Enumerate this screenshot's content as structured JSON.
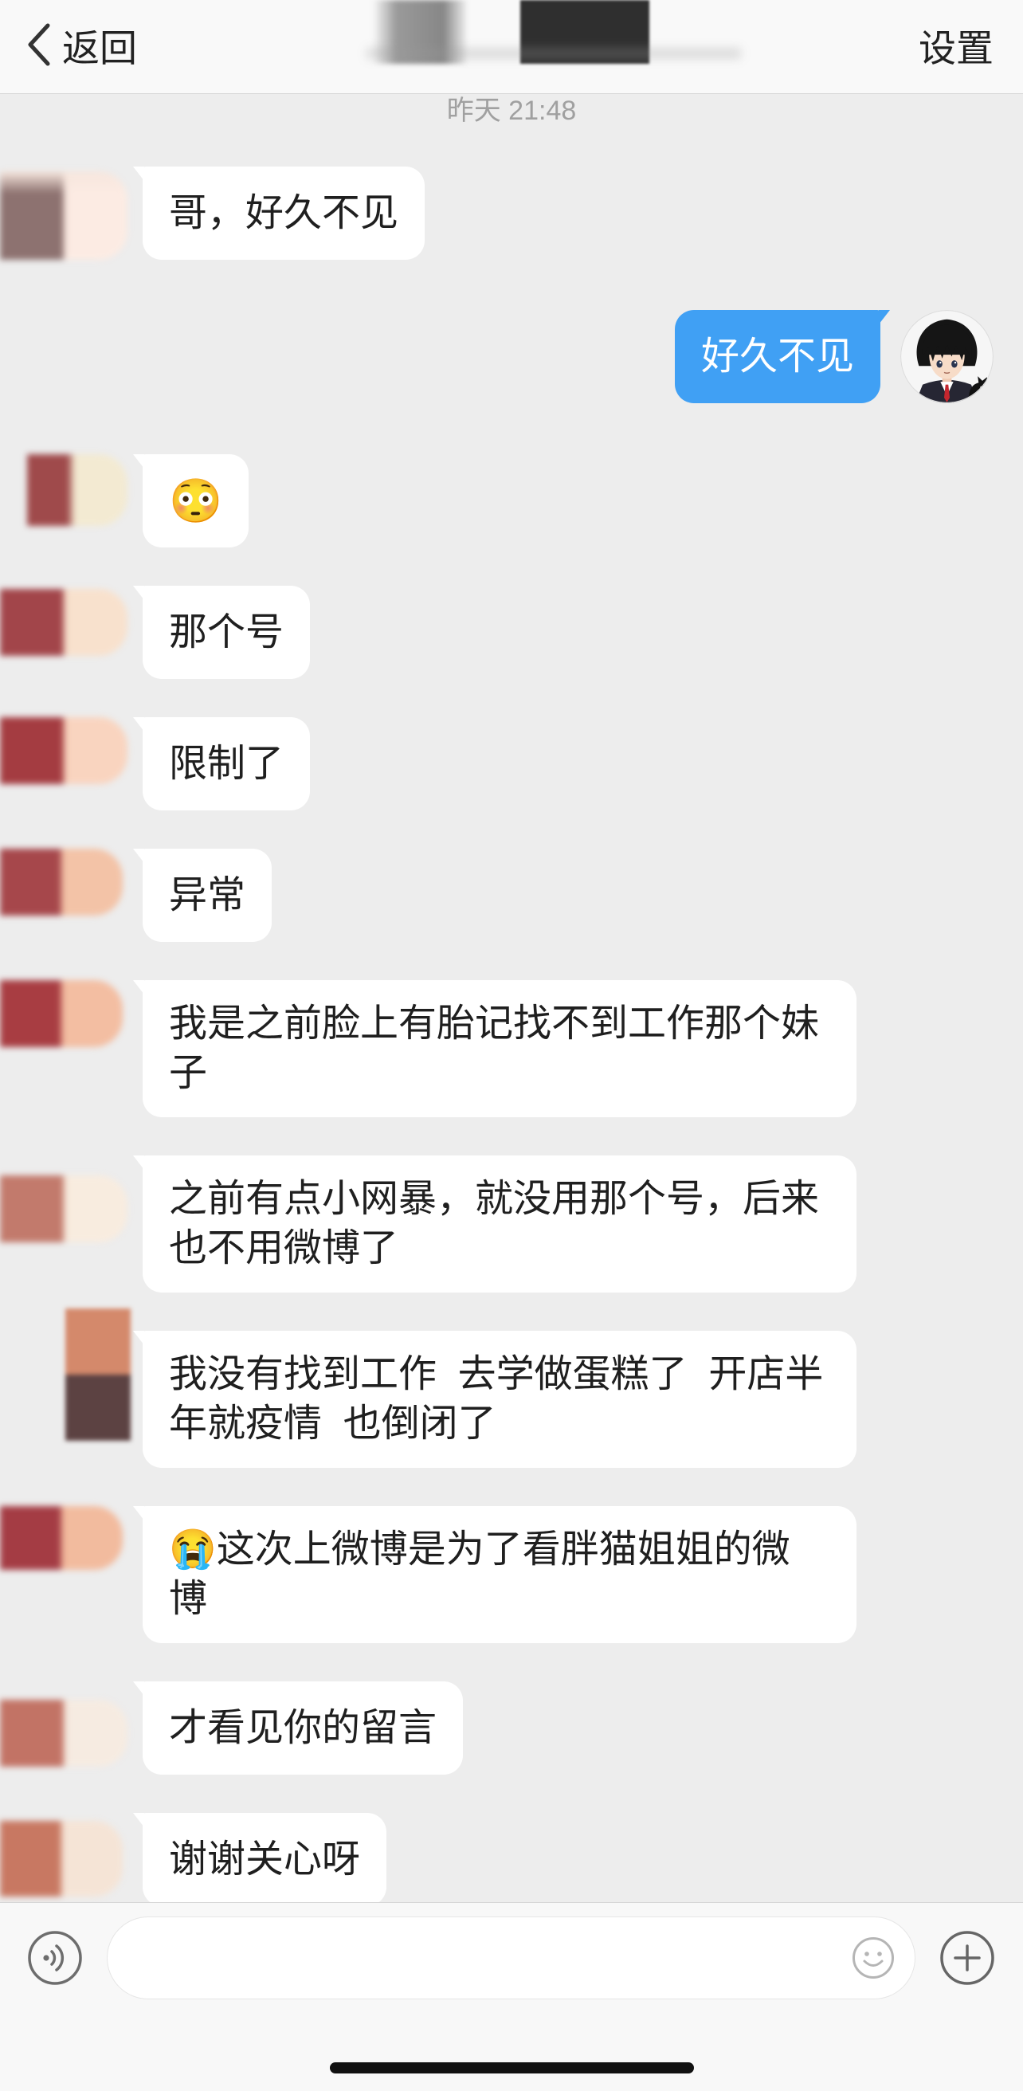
{
  "header": {
    "back_label": "返回",
    "settings_label": "设置",
    "back_icon": "chevron-left-icon"
  },
  "timestamp": "昨天 21:48",
  "messages": [
    {
      "outgoing": false,
      "lines": [
        "哥，好久不见"
      ]
    },
    {
      "outgoing": true,
      "lines": [
        "好久不见"
      ]
    },
    {
      "outgoing": false,
      "lines": [
        "😳"
      ]
    },
    {
      "outgoing": false,
      "lines": [
        "那个号"
      ]
    },
    {
      "outgoing": false,
      "lines": [
        "限制了"
      ]
    },
    {
      "outgoing": false,
      "lines": [
        "异常"
      ]
    },
    {
      "outgoing": false,
      "lines": [
        "我是之前脸上有胎记找不到工作那个妹",
        "子"
      ]
    },
    {
      "outgoing": false,
      "lines": [
        "之前有点小网暴，就没用那个号，后来",
        "也不用微博了"
      ]
    },
    {
      "outgoing": false,
      "lines": [
        "我没有找到工作  去学做蛋糕了  开店半",
        "年就疫情  也倒闭了"
      ]
    },
    {
      "outgoing": false,
      "lines": [
        "😭这次上微博是为了看胖猫姐姐的微",
        "博"
      ]
    },
    {
      "outgoing": false,
      "lines": [
        "才看见你的留言"
      ]
    },
    {
      "outgoing": false,
      "lines": [
        "谢谢关心呀"
      ]
    }
  ],
  "composer": {
    "value": "",
    "voice_icon": "voice-icon",
    "emoji_icon": "smiley-icon",
    "add_icon": "plus-circle-icon"
  },
  "colors": {
    "outgoing_bubble": "#40a0f4",
    "incoming_bubble": "#ffffff",
    "chat_background": "#ededed",
    "timestamp_text": "#a0a0a0"
  }
}
